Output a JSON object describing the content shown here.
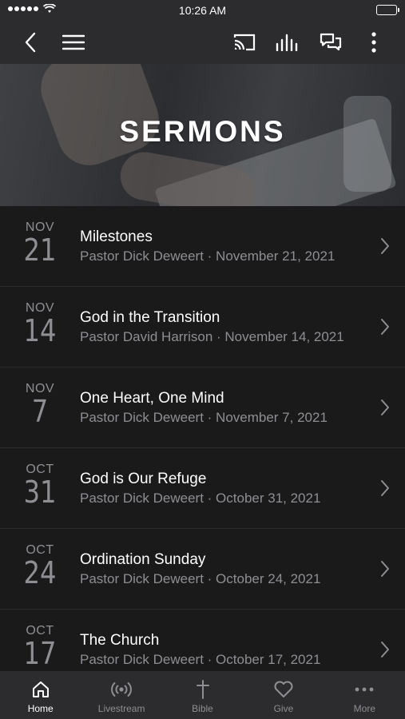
{
  "status": {
    "time": "10:26 AM"
  },
  "hero": {
    "title": "SERMONS"
  },
  "sermons": [
    {
      "month": "NOV",
      "day": "21",
      "title": "Milestones",
      "subtitle": "Pastor Dick Deweert · November 21, 2021"
    },
    {
      "month": "NOV",
      "day": "14",
      "title": "God in the Transition",
      "subtitle": "Pastor David Harrison · November 14, 2021"
    },
    {
      "month": "NOV",
      "day": "7",
      "title": "One Heart, One Mind",
      "subtitle": "Pastor Dick Deweert · November 7, 2021"
    },
    {
      "month": "OCT",
      "day": "31",
      "title": "God is Our Refuge",
      "subtitle": "Pastor Dick Deweert · October 31, 2021"
    },
    {
      "month": "OCT",
      "day": "24",
      "title": "Ordination Sunday",
      "subtitle": "Pastor Dick Deweert · October 24, 2021"
    },
    {
      "month": "OCT",
      "day": "17",
      "title": "The Church",
      "subtitle": "Pastor Dick Deweert · October 17, 2021"
    }
  ],
  "tabs": [
    {
      "label": "Home",
      "icon": "home-icon",
      "active": true
    },
    {
      "label": "Livestream",
      "icon": "broadcast-icon",
      "active": false
    },
    {
      "label": "Bible",
      "icon": "cross-icon",
      "active": false
    },
    {
      "label": "Give",
      "icon": "heart-icon",
      "active": false
    },
    {
      "label": "More",
      "icon": "more-dots-icon",
      "active": false
    }
  ],
  "colors": {
    "background": "#1a1a1b",
    "bar": "#2c2c2e",
    "muted": "#8e8e93",
    "text": "#ffffff"
  }
}
